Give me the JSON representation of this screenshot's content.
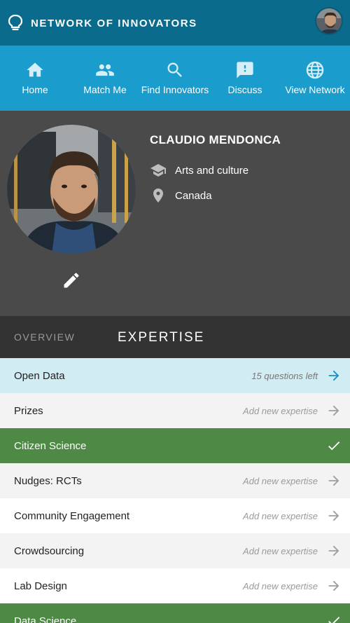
{
  "header": {
    "brand": "NETWORK OF INNOVATORS",
    "logo_icon": "lightbulb-icon",
    "avatar_icon": "user-avatar"
  },
  "nav": [
    {
      "label": "Home",
      "icon": "home-icon"
    },
    {
      "label": "Match Me",
      "icon": "people-icon"
    },
    {
      "label": "Find Innovators",
      "icon": "search-icon"
    },
    {
      "label": "Discuss",
      "icon": "chat-alert-icon"
    },
    {
      "label": "View Network",
      "icon": "globe-icon"
    }
  ],
  "profile": {
    "name": "CLAUDIO MENDONCA",
    "field": "Arts and culture",
    "country": "Canada"
  },
  "tabs": {
    "overview": "OVERVIEW",
    "expertise": "EXPERTISE",
    "active": "expertise"
  },
  "expertise": [
    {
      "label": "Open Data",
      "status": "15 questions left",
      "state": "in-progress"
    },
    {
      "label": "Prizes",
      "status": "Add new expertise",
      "state": "new"
    },
    {
      "label": "Citizen Science",
      "status": "",
      "state": "done"
    },
    {
      "label": "Nudges: RCTs",
      "status": "Add new expertise",
      "state": "new"
    },
    {
      "label": "Community Engagement",
      "status": "Add new expertise",
      "state": "new"
    },
    {
      "label": "Crowdsourcing",
      "status": "Add new expertise",
      "state": "new"
    },
    {
      "label": "Lab Design",
      "status": "Add new expertise",
      "state": "new"
    },
    {
      "label": "Data Science",
      "status": "",
      "state": "done"
    }
  ],
  "colors": {
    "topbar": "#0a6b8c",
    "nav": "#1a9ccd",
    "profile_bg": "#4a4a4a",
    "tabs_bg": "#333333",
    "done_row": "#4e8a45",
    "in_progress_row": "#d1ecf3"
  }
}
